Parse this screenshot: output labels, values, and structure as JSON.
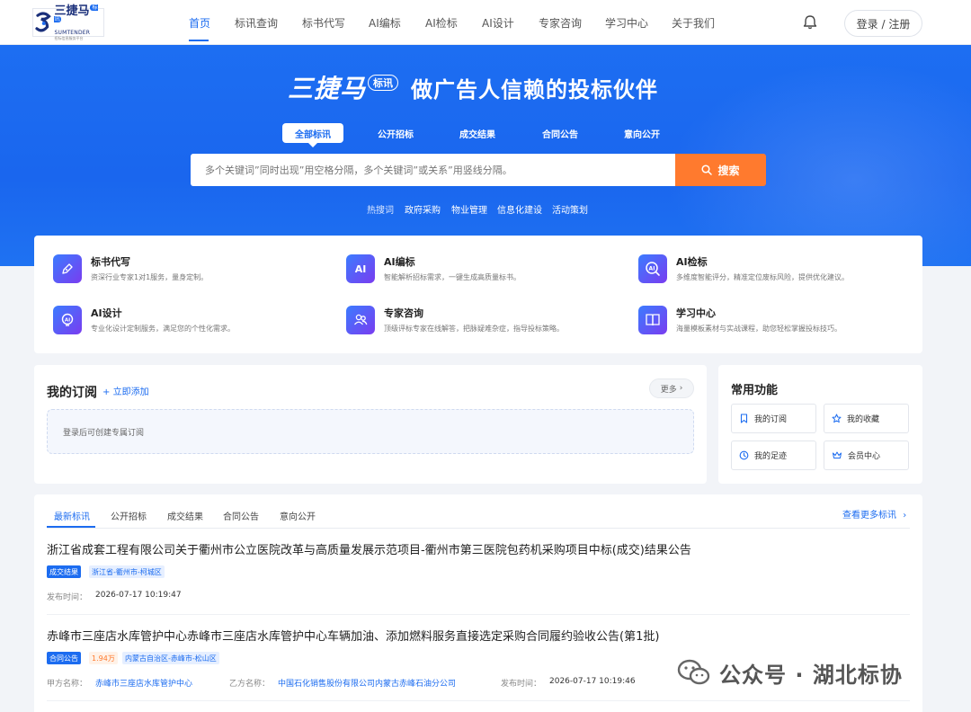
{
  "nav": {
    "logo": {
      "brand": "三捷马",
      "badge": "标讯",
      "sub": "SUMTENDER",
      "tagline": "招标信息服务平台"
    },
    "items": [
      "首页",
      "标讯查询",
      "标书代写",
      "AI编标",
      "AI检标",
      "AI设计",
      "专家咨询",
      "学习中心",
      "关于我们"
    ],
    "active_index": 0,
    "login_label": "登录 / 注册"
  },
  "hero": {
    "brand": "三捷马",
    "badge": "标讯",
    "slogan": "做广告人信赖的投标伙伴",
    "tabs": [
      "全部标讯",
      "公开招标",
      "成交结果",
      "合同公告",
      "意向公开"
    ],
    "active_tab": 0,
    "search_placeholder": "多个关键词”同时出现”用空格分隔，多个关键词”或关系”用竖线分隔。",
    "search_button": "搜索",
    "hot_label": "热搜词",
    "hot_words": [
      "政府采购",
      "物业管理",
      "信息化建设",
      "活动策划"
    ]
  },
  "services": [
    {
      "name": "标书代写",
      "desc": "资深行业专家1对1服务，量身定制。",
      "icon": "pen-icon"
    },
    {
      "name": "AI编标",
      "desc": "智能解析招标需求，一键生成高质量标书。",
      "icon": "ai-icon"
    },
    {
      "name": "AI检标",
      "desc": "多维度智能评分，精准定位废标风险，提供优化建议。",
      "icon": "ai-search-icon"
    },
    {
      "name": "AI设计",
      "desc": "专业化设计定制服务，满足您的个性化需求。",
      "icon": "ai-bulb-icon"
    },
    {
      "name": "专家咨询",
      "desc": "顶级评标专家在线解答，把脉疑难杂症，指导投标策略。",
      "icon": "experts-icon"
    },
    {
      "name": "学习中心",
      "desc": "海量模板素材与实战课程，助您轻松掌握投标技巧。",
      "icon": "book-icon"
    }
  ],
  "subscription": {
    "title": "我的订阅",
    "add_label": "立即添加",
    "more_label": "更多",
    "empty_text": "登录后可创建专属订阅"
  },
  "common": {
    "title": "常用功能",
    "buttons": [
      {
        "label": "我的订阅",
        "icon": "bookmark-icon"
      },
      {
        "label": "我的收藏",
        "icon": "star-icon"
      },
      {
        "label": "我的足迹",
        "icon": "clock-icon"
      },
      {
        "label": "会员中心",
        "icon": "crown-icon"
      }
    ]
  },
  "listing": {
    "tabs": [
      "最新标讯",
      "公开招标",
      "成交结果",
      "合同公告",
      "意向公开"
    ],
    "active_tab": 0,
    "more_label": "查看更多标讯",
    "items": [
      {
        "title": "浙江省成套工程有限公司关于衢州市公立医院改革与高质量发展示范项目-衢州市第三医院包药机采购项目中标(成交)结果公告",
        "type_tag": "成交结果",
        "region_tag": "浙江省-衢州市-柯城区",
        "time_label": "发布时间：",
        "time": "2026-07-17 10:19:47"
      },
      {
        "title": "赤峰市三座店水库管护中心赤峰市三座店水库管护中心车辆加油、添加燃料服务直接选定采购合同履约验收公告(第1批)",
        "type_tag": "合同公告",
        "amount_tag": "1.94万",
        "region_tag": "内蒙古自治区-赤峰市-松山区",
        "party_a_label": "甲方名称：",
        "party_a": "赤峰市三座店水库管护中心",
        "party_b_label": "乙方名称：",
        "party_b": "中国石化销售股份有限公司内蒙古赤峰石油分公司",
        "time_label": "发布时间：",
        "time": "2026-07-17 10:19:46"
      }
    ]
  },
  "watermark": {
    "text": "公众号 · 湖北标协"
  },
  "colors": {
    "primary": "#1c6cf0",
    "accent": "#ff7a2e",
    "hero_bg": "#1d6ef2"
  }
}
